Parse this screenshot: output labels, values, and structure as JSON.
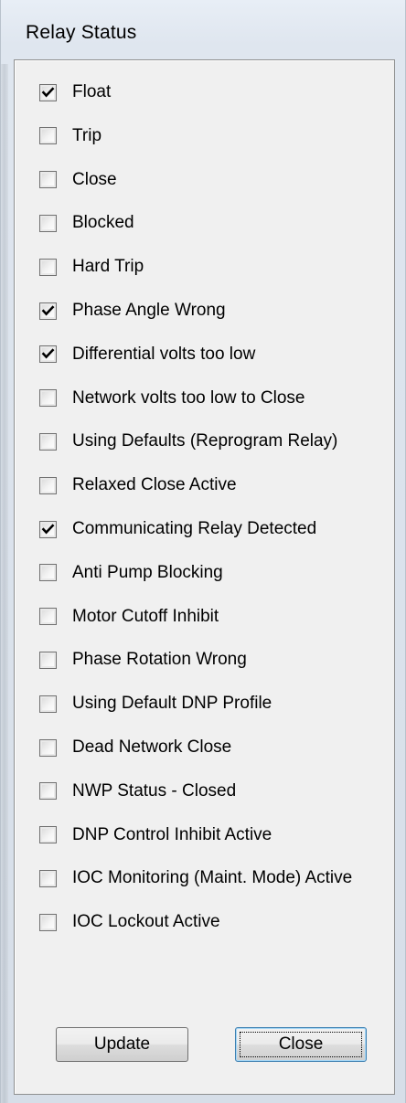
{
  "window": {
    "title": "Relay Status"
  },
  "items": [
    {
      "label": "Float",
      "checked": true
    },
    {
      "label": "Trip",
      "checked": false
    },
    {
      "label": "Close",
      "checked": false
    },
    {
      "label": "Blocked",
      "checked": false
    },
    {
      "label": "Hard Trip",
      "checked": false
    },
    {
      "label": "Phase Angle Wrong",
      "checked": true
    },
    {
      "label": "Differential volts too low",
      "checked": true
    },
    {
      "label": "Network volts too low to Close",
      "checked": false
    },
    {
      "label": "Using Defaults (Reprogram Relay)",
      "checked": false
    },
    {
      "label": "Relaxed Close Active",
      "checked": false
    },
    {
      "label": "Communicating Relay Detected",
      "checked": true
    },
    {
      "label": "Anti Pump Blocking",
      "checked": false
    },
    {
      "label": "Motor Cutoff Inhibit",
      "checked": false
    },
    {
      "label": "Phase Rotation Wrong",
      "checked": false
    },
    {
      "label": "Using Default DNP Profile",
      "checked": false
    },
    {
      "label": "Dead Network Close",
      "checked": false
    },
    {
      "label": "NWP Status - Closed",
      "checked": false
    },
    {
      "label": "DNP Control Inhibit Active",
      "checked": false
    },
    {
      "label": "IOC Monitoring (Maint. Mode) Active",
      "checked": false
    },
    {
      "label": "IOC Lockout Active",
      "checked": false
    }
  ],
  "buttons": {
    "update_label": "Update",
    "close_label": "Close"
  },
  "icons": {
    "checkmark": "checkmark-icon"
  },
  "colors": {
    "checkmark": "#000000"
  }
}
